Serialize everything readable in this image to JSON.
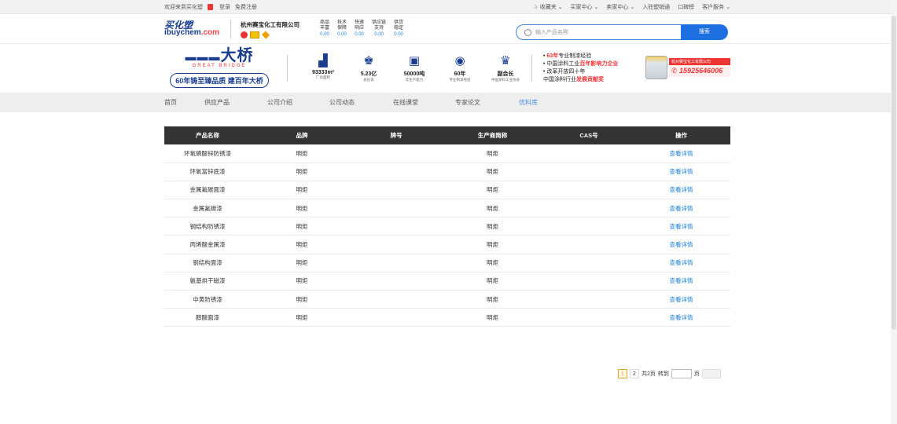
{
  "topbar": {
    "welcome": "欢迎来到买化塑",
    "login": "登录",
    "register": "免费注册",
    "right": [
      "☆ 收藏夹 ⌄",
      "买家中心 ⌄",
      "卖家中心 ⌄",
      "入驻塑销通",
      "口碑榜",
      "客户服务 ⌄"
    ]
  },
  "header": {
    "logo_cn": "买化塑",
    "logo_en_a": "ibuychem",
    "logo_en_b": ".com",
    "company_name": "杭州赛宝化工有限公司",
    "stats": [
      {
        "l1": "商品",
        "l2": "丰富",
        "v": "0.00"
      },
      {
        "l1": "技术",
        "l2": "保障",
        "v": "0.00"
      },
      {
        "l1": "快速",
        "l2": "响应",
        "v": "0.00"
      },
      {
        "l1": "供应链",
        "l2": "支持",
        "v": "0.00"
      },
      {
        "l1": "供货",
        "l2": "稳定",
        "v": "0.00"
      }
    ],
    "search_placeholder": "输入产品名称",
    "search_button": "搜索"
  },
  "banner": {
    "brand_cn": "大桥",
    "brand_en": "GREAT BRIDGE",
    "slogan": "60年铸至臻品质 建百年大桥",
    "facts": [
      {
        "icon": "factory-icon",
        "glyph": "▟",
        "v": "93333m²",
        "l": "厂房面积"
      },
      {
        "icon": "investment-icon",
        "glyph": "♚",
        "v": "5.23亿",
        "l": "总投资"
      },
      {
        "icon": "capacity-icon",
        "glyph": "▣",
        "v": "50000吨",
        "l": "年生产能力"
      },
      {
        "icon": "experience-icon",
        "glyph": "◉",
        "v": "60年",
        "l": "专业制漆经验"
      },
      {
        "icon": "trophy-icon",
        "glyph": "♛",
        "v": "副会长",
        "l": "中国涂料工业协会"
      }
    ],
    "bullets": [
      {
        "a": "• ",
        "r": "63年",
        "b": "专业制漆经验"
      },
      {
        "a": "• 中国涂料工业",
        "r": "百年影响力企业",
        "b": ""
      },
      {
        "a": "• 改革开放四十年",
        "r": "",
        "b": ""
      },
      {
        "a": "  中国涂料行业",
        "r": "发展贡献奖",
        "b": ""
      }
    ],
    "product_tag": "杭州赛宝化工有限公司",
    "phone": "15925646006"
  },
  "nav": {
    "items": [
      "首页",
      "供应产品",
      "公司介绍",
      "公司动态",
      "在线课堂",
      "专家论文",
      "优料库"
    ],
    "active_index": 6
  },
  "table": {
    "headers": [
      "产品名称",
      "品牌",
      "牌号",
      "生产商简称",
      "CAS号",
      "操作"
    ],
    "rows": [
      [
        "环氧磷酸锌防锈漆",
        "明炬",
        "",
        "明炬",
        "",
        "查看详情"
      ],
      [
        "环氧富锌底漆",
        "明炬",
        "",
        "明炬",
        "",
        "查看详情"
      ],
      [
        "金属氟碳面漆",
        "明炬",
        "",
        "明炬",
        "",
        "查看详情"
      ],
      [
        "金属氟碳漆",
        "明炬",
        "",
        "明炬",
        "",
        "查看详情"
      ],
      [
        "钢结构防锈漆",
        "明炬",
        "",
        "明炬",
        "",
        "查看详情"
      ],
      [
        "丙烯酸金属漆",
        "明炬",
        "",
        "明炬",
        "",
        "查看详情"
      ],
      [
        "钢结构面漆",
        "明炬",
        "",
        "明炬",
        "",
        "查看详情"
      ],
      [
        "氨基烘干磁漆",
        "明炬",
        "",
        "明炬",
        "",
        "查看详情"
      ],
      [
        "中黄防锈漆",
        "明炬",
        "",
        "明炬",
        "",
        "查看详情"
      ],
      [
        "醇酸面漆",
        "明炬",
        "",
        "明炬",
        "",
        "查看详情"
      ]
    ]
  },
  "pager": {
    "pages": [
      "1",
      "2"
    ],
    "total": "共2页",
    "goto": "转到",
    "page_unit": "页"
  },
  "colors": {
    "accent": "#1e6fe0",
    "brand": "#1a3d8f",
    "red": "#e33",
    "table_head": "#333333"
  }
}
